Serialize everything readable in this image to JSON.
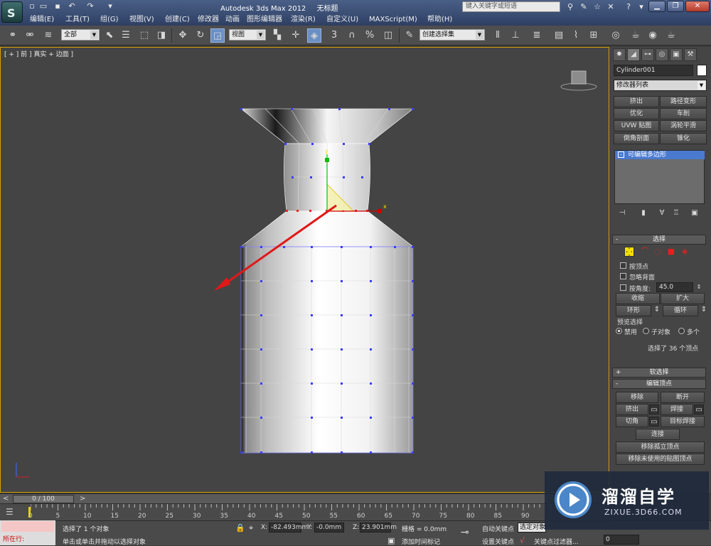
{
  "window": {
    "app_name": "Autodesk 3ds Max  2012",
    "doc_name": "无标题",
    "search_placeholder": "键入关键字或短语",
    "min": "▁",
    "restore": "❐",
    "close": "✕"
  },
  "menu": [
    "编辑(E)",
    "工具(T)",
    "组(G)",
    "视图(V)",
    "创建(C)",
    "修改器",
    "动画",
    "图形编辑器",
    "渲染(R)",
    "自定义(U)",
    "MAXScript(M)",
    "帮助(H)"
  ],
  "toolbar": {
    "selection_filter": "全部",
    "ref_coord": "视图",
    "named_selection": "创建选择集",
    "snap_3": "3",
    "snap_2": "2.5"
  },
  "viewport": {
    "label": "[ + ] 前 ] 真实 + 边面 ]",
    "viewcube_face": "前"
  },
  "panel": {
    "object_name": "Cylinder001",
    "modifier_list": "修改器列表",
    "modifier_buttons": [
      "挤出",
      "路径变形",
      "优化",
      "车削",
      "UVW 贴图",
      "涡轮平滑",
      "倒角剖面",
      "锥化"
    ],
    "stack_item": "可编辑多边形",
    "selection_header": "选择",
    "by_vertex": "按顶点",
    "ignore_backfacing": "忽略背面",
    "by_angle": "按角度:",
    "angle_value": "45.0",
    "shrink": "收缩",
    "grow": "扩大",
    "ring": "环形",
    "loop": "循环",
    "preview_label": "预览选择",
    "preview_options": [
      "禁用",
      "子对象",
      "多个"
    ],
    "selection_status": "选择了 36 个顶点",
    "soft_selection": "软选择",
    "edit_vertices": "编辑顶点",
    "remove": "移除",
    "break": "断开",
    "extrude": "挤出",
    "weld": "焊接",
    "chamfer": "切角",
    "target_weld": "目标焊接",
    "connect": "连接",
    "remove_isolated": "移除孤立顶点",
    "remove_unused_map": "移除未使用的贴图顶点"
  },
  "timeline": {
    "frame_display": "0 / 100",
    "ticks": [
      "0",
      "5",
      "10",
      "15",
      "20",
      "25",
      "30",
      "35",
      "40",
      "45",
      "50",
      "55",
      "60",
      "65",
      "70",
      "75",
      "80",
      "85",
      "90"
    ]
  },
  "status": {
    "listener_label": "所在行:",
    "selected": "选择了 1 个对象",
    "prompt": "单击或单击并拖动以选择对象",
    "x_label": "X:",
    "x_value": "-82.493mm",
    "y_label": "Y:",
    "y_value": "-0.0mm",
    "z_label": "Z:",
    "z_value": "23.901mm",
    "grid": "栅格 = 0.0mm",
    "add_time_tag": "添加时间标记",
    "auto_key": "自动关键点",
    "selected_keys": "选定对象",
    "set_key": "设置关键点",
    "key_filters": "关键点过滤器...",
    "frame_value": "0"
  },
  "watermark": {
    "title": "溜溜自学",
    "url": "ZIXUE.3D66.COM"
  }
}
